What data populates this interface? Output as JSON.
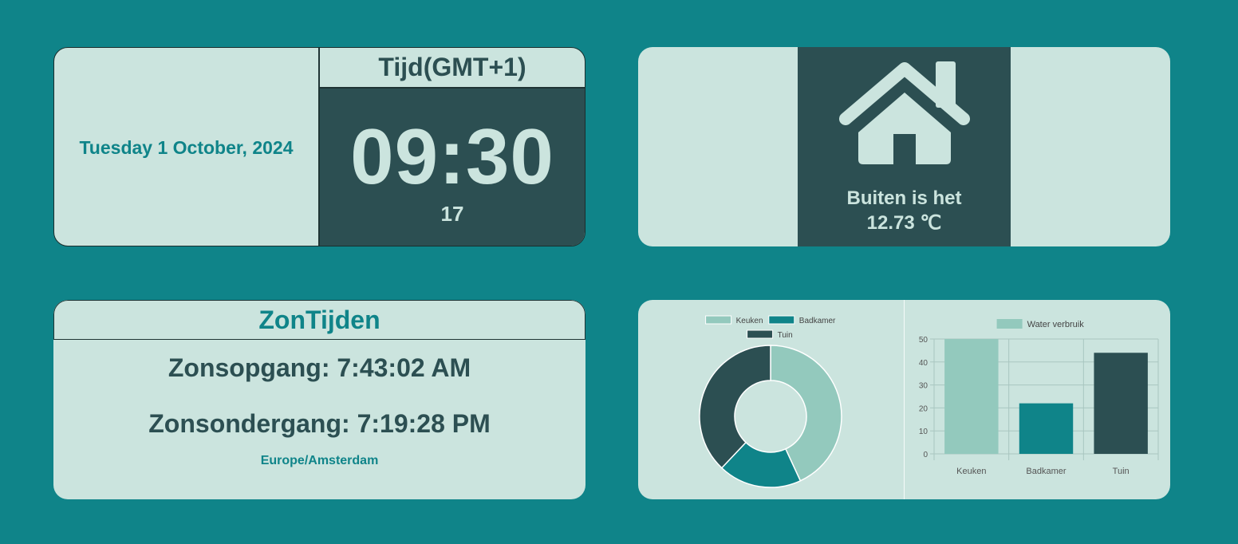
{
  "time_widget": {
    "date": "Tuesday 1 October, 2024",
    "timezone_label": "Tijd(GMT+1)",
    "time": "09:30",
    "seconds": "17"
  },
  "weather_widget": {
    "icon": "house-icon",
    "label": "Buiten is het",
    "temperature": "12.73 ℃"
  },
  "sun_widget": {
    "title": "ZonTijden",
    "sunrise": "Zonsopgang: 7:43:02 AM",
    "sunset": "Zonsondergang: 7:19:28 PM",
    "timezone": "Europe/Amsterdam"
  },
  "colors": {
    "background": "#0f8489",
    "card": "#cbe4de",
    "dark": "#2c4f52",
    "accent": "#0f8489",
    "light_series": "#93c9bd"
  },
  "chart_data": [
    {
      "type": "pie",
      "subtype": "doughnut",
      "legend": [
        "Keuken",
        "Badkamer",
        "Tuin"
      ],
      "legend_position": "top",
      "values": [
        50,
        22,
        44
      ],
      "colors": [
        "#93c9bd",
        "#0f8489",
        "#2c4f52"
      ]
    },
    {
      "type": "bar",
      "categories": [
        "Keuken",
        "Badkamer",
        "Tuin"
      ],
      "series": [
        {
          "name": "Water verbruik",
          "values": [
            50,
            22,
            44
          ]
        }
      ],
      "colors": [
        "#93c9bd",
        "#0f8489",
        "#2c4f52"
      ],
      "ylim": [
        0,
        50
      ],
      "yticks": [
        0,
        10,
        20,
        30,
        40,
        50
      ],
      "grid": true,
      "legend_position": "top"
    }
  ]
}
